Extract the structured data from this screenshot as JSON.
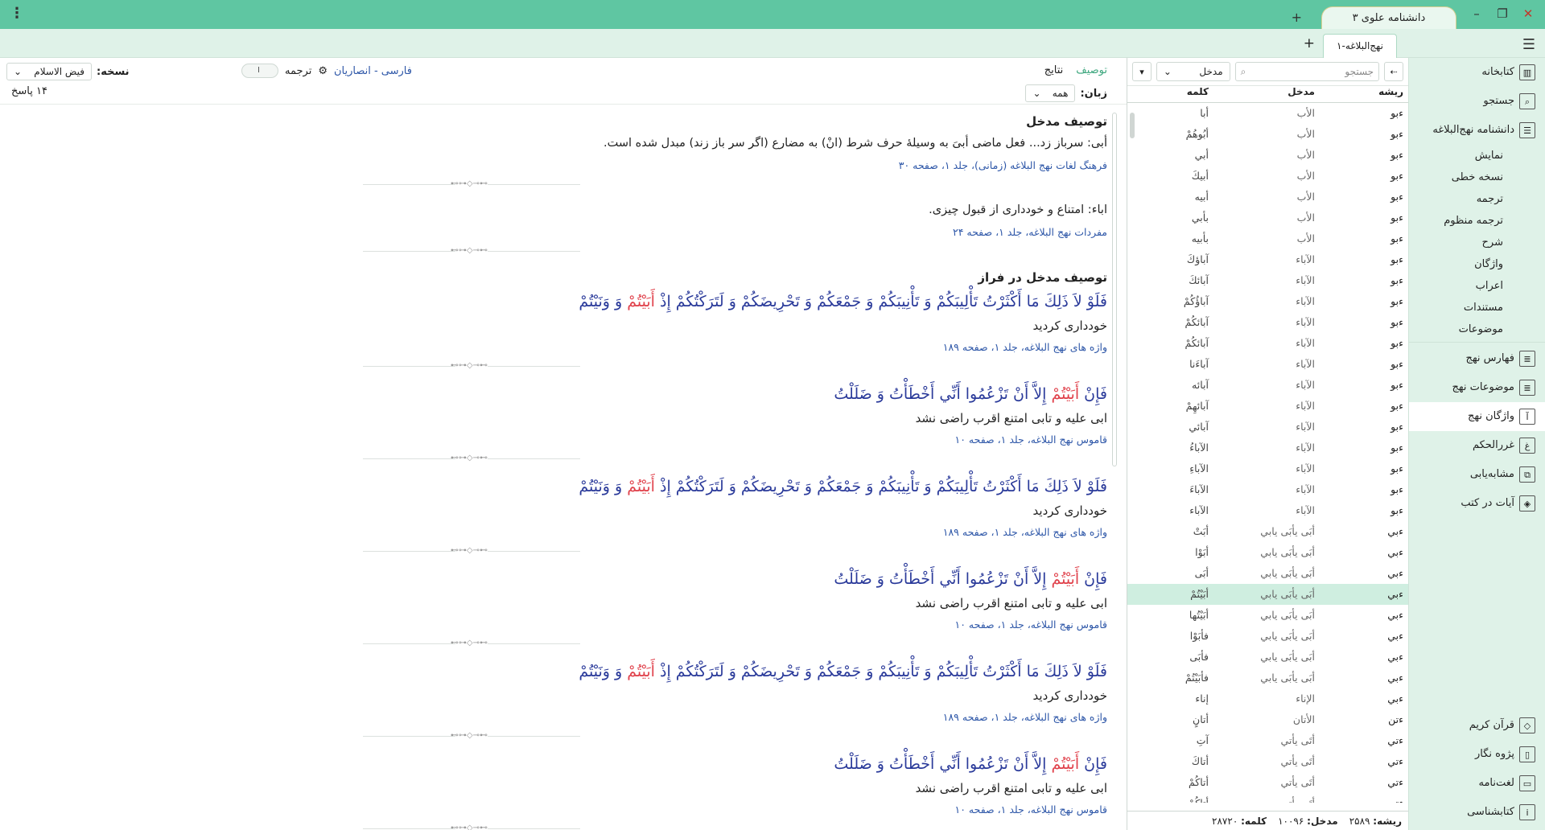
{
  "app": {
    "title": "دانشنامه علوی ۳"
  },
  "tabs": {
    "doc_title": "نهج‌البلاغه-۱"
  },
  "sidebar": {
    "items": [
      {
        "label": "کتابخانه",
        "icon": "library-icon",
        "glyph": "▥"
      },
      {
        "label": "جستجو",
        "icon": "search-icon",
        "glyph": "⌕"
      },
      {
        "label": "دانشنامه نهج‌البلاغه",
        "icon": "list-icon",
        "glyph": "☰"
      }
    ],
    "subitems": [
      "نمایش",
      "نسخه خطی",
      "ترجمه",
      "ترجمه منظوم",
      "شرح",
      "واژگان",
      "اعراب",
      "مستندات",
      "موضوعات"
    ],
    "items2": [
      {
        "label": "فهارس نهج",
        "icon": "index-icon",
        "glyph": "≣"
      },
      {
        "label": "موضوعات نهج",
        "icon": "topics-icon",
        "glyph": "≣"
      },
      {
        "label": "واژگان نهج",
        "icon": "vocab-icon",
        "glyph": "آ"
      },
      {
        "label": "غررالحکم",
        "icon": "ghurar-icon",
        "glyph": "غ"
      },
      {
        "label": "مشابه‌یابی",
        "icon": "similar-icon",
        "glyph": "⧉"
      },
      {
        "label": "آیات در کتب",
        "icon": "verses-icon",
        "glyph": "◈"
      }
    ],
    "bottom_items": [
      {
        "label": "قرآن کریم",
        "icon": "quran-icon",
        "glyph": "◇"
      },
      {
        "label": "پژوه نگار",
        "icon": "notes-icon",
        "glyph": "▯"
      },
      {
        "label": "لغت‌نامه",
        "icon": "dictionary-icon",
        "glyph": "▭"
      },
      {
        "label": "کتابشناسی",
        "icon": "info-icon",
        "glyph": "i"
      }
    ]
  },
  "listpanel": {
    "search_placeholder": "جستجو",
    "entry_select": "مدخل",
    "headers": {
      "root": "ریشه",
      "entry": "مدخل",
      "word": "کلمه"
    },
    "rows": [
      [
        "ءبو",
        "الأب",
        "أبا"
      ],
      [
        "ءبو",
        "الأب",
        "أبُوهُمْ"
      ],
      [
        "ءبو",
        "الأب",
        "أبي"
      ],
      [
        "ءبو",
        "الأب",
        "أبيكَ"
      ],
      [
        "ءبو",
        "الأب",
        "أبيه"
      ],
      [
        "ءبو",
        "الأب",
        "بأبي"
      ],
      [
        "ءبو",
        "الأب",
        "بأبيه"
      ],
      [
        "ءبو",
        "الآباء",
        "آباؤكَ"
      ],
      [
        "ءبو",
        "الآباء",
        "آبائكَ"
      ],
      [
        "ءبو",
        "الآباء",
        "آباؤُكُمْ"
      ],
      [
        "ءبو",
        "الآباء",
        "آبائكُمْ"
      ],
      [
        "ءبو",
        "الآباء",
        "آبائكُمْ"
      ],
      [
        "ءبو",
        "الآباء",
        "آباءَنا"
      ],
      [
        "ءبو",
        "الآباء",
        "آبائه"
      ],
      [
        "ءبو",
        "الآباء",
        "آبائهِمْ"
      ],
      [
        "ءبو",
        "الآباء",
        "آبائي"
      ],
      [
        "ءبو",
        "الآباء",
        "الآباءُ"
      ],
      [
        "ءبو",
        "الآباء",
        "الآباءِ"
      ],
      [
        "ءبو",
        "الآباء",
        "الآباءَ"
      ],
      [
        "ءبو",
        "الآباء",
        "الآباء"
      ],
      [
        "ءبي",
        "أبَى يأبَى يابي",
        "أبَتْ"
      ],
      [
        "ءبي",
        "أبَى يأبَى يابي",
        "أبَوْا"
      ],
      [
        "ءبي",
        "أبَى يأبَى يابي",
        "أبَى"
      ],
      [
        "ءبي",
        "أبَى يأبَى يابي",
        "أبَيْتُمْ"
      ],
      [
        "ءبي",
        "أبَى يأبَى يابي",
        "أبَيْتُها"
      ],
      [
        "ءبي",
        "أبَى يأبَى يابي",
        "فأبَوْا"
      ],
      [
        "ءبي",
        "أبَى يأبَى يابي",
        "فأبَى"
      ],
      [
        "ءبي",
        "أبَى يأبَى يابي",
        "فأبَيْتُمْ"
      ],
      [
        "ءبي",
        "الإناء",
        "إناء"
      ],
      [
        "ءتن",
        "الأتان",
        "أتانٍ"
      ],
      [
        "ءتي",
        "أتَى يأتي",
        "آتِ"
      ],
      [
        "ءتي",
        "أتَى يأتي",
        "أتاكَ"
      ],
      [
        "ءتي",
        "أتَى يأتي",
        "أتاكُمْ"
      ],
      [
        "ءتي",
        "أتَى يأتي",
        "أتاكُمْ"
      ]
    ],
    "selected_index": 23,
    "footer": {
      "root_label": "ریشه:",
      "root_value": "۲۵۸۹",
      "entry_label": "مدخل:",
      "entry_value": "۱۰۰۹۶",
      "word_label": "کلمه:",
      "word_value": "۲۸۷۲۰"
    }
  },
  "main": {
    "tabs": {
      "description": "توصیف",
      "results": "نتایج"
    },
    "lang_label": "فارسی - انصاریان",
    "translation_label": "ترجمه",
    "toggle_text": "I",
    "version_label": "نسخه:",
    "version_value": "فیض الاسلام",
    "language_filter_label": "زبان:",
    "language_filter_value": "همه",
    "answers_count": "۱۴ پاسخ",
    "entry_desc_title": "توصیف مدخل",
    "desc1": "أبی: سرباز زد... فعل ماضی أبیَ به وسیلۀ حرف شرط (انْ) به مضارع (اگر سر باز زند) مبدل شده است.",
    "src1": "فرهنگ لغات نهج البلاغه (زمانی)، جلد ۱، صفحه ۳۰",
    "desc2": "اباء: امتناع و خودداری از قبول چیزی.",
    "src2": "مفردات نهج البلاغه، جلد ۱، صفحه ۲۴",
    "phrase_desc_title": "توصیف مدخل در فراز",
    "quoteA_pre": "فَلَوْ لاَ ذَلِكَ مَا أَكْثَرْتُ تَأْلِيبَكُمْ وَ تَأْنِيبَكُمْ وَ جَمْعَكُمْ وَ تَحْرِيضَكُمْ وَ لَتَرَكْتُكُمْ إِذْ ",
    "quoteA_hl": "أَبَيْتُمْ",
    "quoteA_post": " وَ وَنَيْتُمْ",
    "transA": "خودداری کردید",
    "srcA": "واژه های نهج البلاغه، جلد ۱، صفحه ۱۸۹",
    "quoteB_pre": "فَإِنْ ",
    "quoteB_hl": "أَبَيْتُمْ",
    "quoteB_post": " إِلاَّ أَنْ تَزْعُمُوا أَنِّي أَخْطَأْتُ وَ ضَلَلْتُ",
    "transB": "ابى علیه و تابى امتنع اقرب راضى نشد",
    "srcB": "قاموس نهج البلاغه، جلد ۱، صفحه ۱۰",
    "divider_glyph": "⊶⊸◇⊷⊶"
  },
  "colors": {
    "accent": "#5fc6a2",
    "link": "#2e57a8",
    "arabic": "#2a3a9a",
    "highlight": "#e0414b"
  }
}
